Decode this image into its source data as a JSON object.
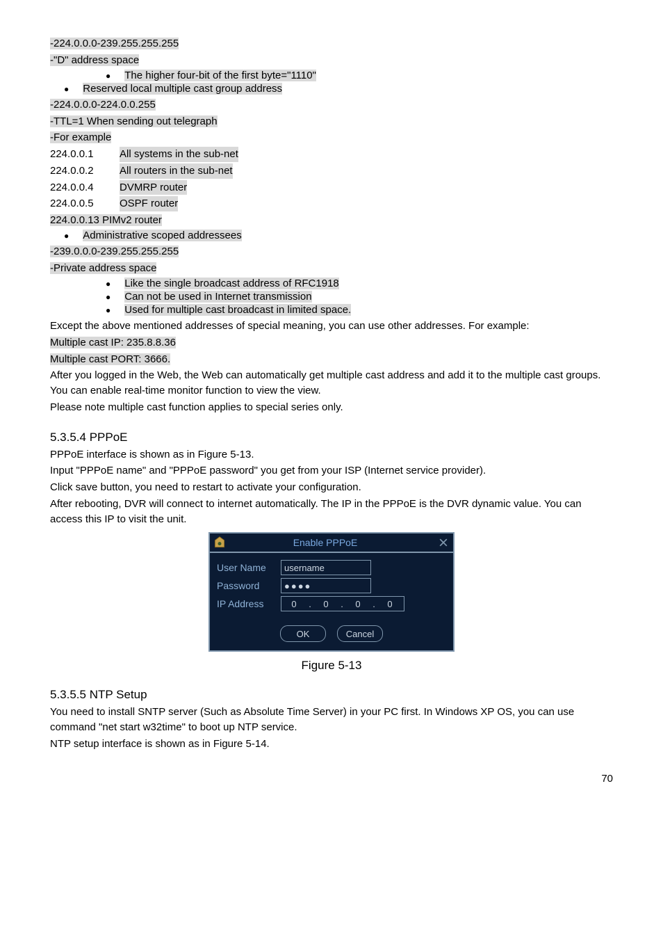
{
  "content": {
    "l_addr_range1": "-224.0.0.0-239.255.255.255",
    "l_d_space": "-\"D\" address space",
    "b_higher": "The higher four-bit of the first byte=\"1110\"",
    "b_reserved": "Reserved local multiple cast group address",
    "l_addr_range2": "-224.0.0.0-224.0.0.255",
    "l_ttl": "-TTL=1 When sending out telegraph",
    "l_for_example": "-For example",
    "ip1_a": "224.0.0.1",
    "ip1_d": "All systems in the sub-net",
    "ip2_a": "224.0.0.2",
    "ip2_d": "All routers in the sub-net",
    "ip3_a": "224.0.0.4",
    "ip3_d": "DVMRP router",
    "ip4_a": "224.0.0.5",
    "ip4_d": "OSPF router",
    "ip5": "224.0.0.13 PIMv2 router",
    "b_admin": "Administrative scoped addressees",
    "l_addr_range3": "-239.0.0.0-239.255.255.255",
    "l_private": "-Private address space",
    "b_like": "Like the single broadcast address of RFC1918",
    "b_cannot": "Can not be used in Internet transmission",
    "b_used": "Used for multiple cast broadcast in limited space.",
    "l_except": "Except the above mentioned addresses of special meaning, you can use other addresses. For example:",
    "l_mcip": "Multiple cast IP: 235.8.8.36",
    "l_mcport": "Multiple cast PORT: 3666.",
    "l_after": "After you logged in the Web, the Web can automatically get multiple cast address and add it to the multiple cast groups. You can enable real-time monitor function to view the view.",
    "l_please": "Please note multiple cast function applies to special series only.",
    "h_pppoe": "5.3.5.4  PPPoE",
    "p1": "PPPoE interface is shown as in Figure 5-13.",
    "p2": "Input \"PPPoE name\" and \"PPPoE password\" you get from your ISP (Internet service provider).",
    "p3": "Click save button, you need to restart to activate your configuration.",
    "p4": "After rebooting, DVR will connect to internet automatically. The IP in the PPPoE is the DVR dynamic value. You can access this IP to visit the unit.",
    "fig_caption": "Figure 5-13",
    "h_ntp": "5.3.5.5  NTP Setup",
    "n1": "You need to install SNTP server (Such as Absolute Time Server) in your PC first. In Windows XP OS, you can use command \"net start w32time\" to boot up NTP service.",
    "n2": "NTP setup interface is shown as in Figure 5-14.",
    "pagenum": "70"
  },
  "dialog": {
    "title": "Enable PPPoE",
    "label_user": "User Name",
    "label_pass": "Password",
    "label_ip": "IP Address",
    "value_user": "username",
    "value_pass": "●●●●",
    "ip": [
      "0",
      "0",
      "0",
      "0"
    ],
    "btn_ok": "OK",
    "btn_cancel": "Cancel"
  }
}
